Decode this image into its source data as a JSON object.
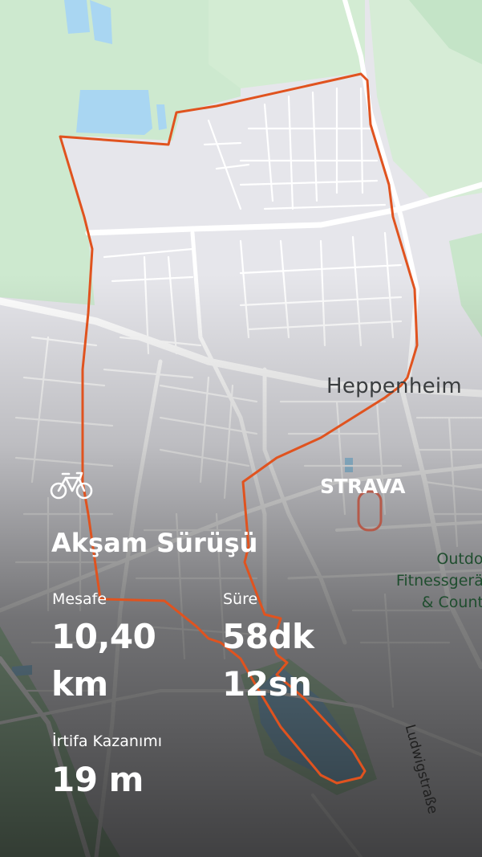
{
  "map": {
    "city_label": "Heppenheim",
    "poi_label_lines": [
      "Outdoor",
      "Fitnessgeräte",
      "& Country"
    ],
    "road_label": "Ludwigstraße",
    "route_color": "#e0531f"
  },
  "brand": {
    "logo_text": "STRAVA",
    "activity_icon": "bicycle-icon"
  },
  "activity": {
    "title": "Akşam Sürüşü",
    "distance": {
      "label": "Mesafe",
      "value": "10,40",
      "unit": "km"
    },
    "duration": {
      "label": "Süre",
      "minutes": "58dk",
      "seconds": "12sn"
    },
    "elevation": {
      "label": "İrtifa Kazanımı",
      "value": "19 m"
    }
  }
}
